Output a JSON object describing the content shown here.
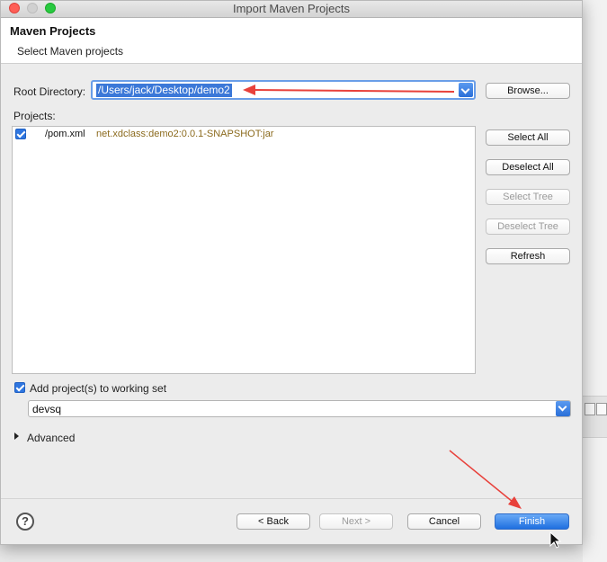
{
  "window": {
    "title": "Import Maven Projects"
  },
  "header": {
    "title": "Maven Projects",
    "subtitle": "Select Maven projects"
  },
  "root": {
    "label": "Root Directory:",
    "value": "/Users/jack/Desktop/demo2",
    "browse_label": "Browse..."
  },
  "projects": {
    "label": "Projects:",
    "items": [
      {
        "path": "/pom.xml",
        "artifact": "net.xdclass:demo2:0.0.1-SNAPSHOT:jar",
        "checked": true
      }
    ]
  },
  "side_buttons": {
    "select_all": "Select All",
    "deselect_all": "Deselect All",
    "select_tree": "Select Tree",
    "deselect_tree": "Deselect Tree",
    "refresh": "Refresh"
  },
  "working_set": {
    "label": "Add project(s) to working set",
    "checked": true,
    "value": "devsq"
  },
  "advanced": {
    "label": "Advanced"
  },
  "footer": {
    "help": "?",
    "back": "< Back",
    "next": "Next >",
    "cancel": "Cancel",
    "finish": "Finish"
  },
  "colors": {
    "accent": "#2f76e0",
    "annotation_arrow": "#e8413b"
  },
  "icons": [
    "help-icon",
    "checkbox-icon",
    "chevron-down-icon",
    "disclosure-triangle-icon",
    "mouse-cursor-icon"
  ]
}
